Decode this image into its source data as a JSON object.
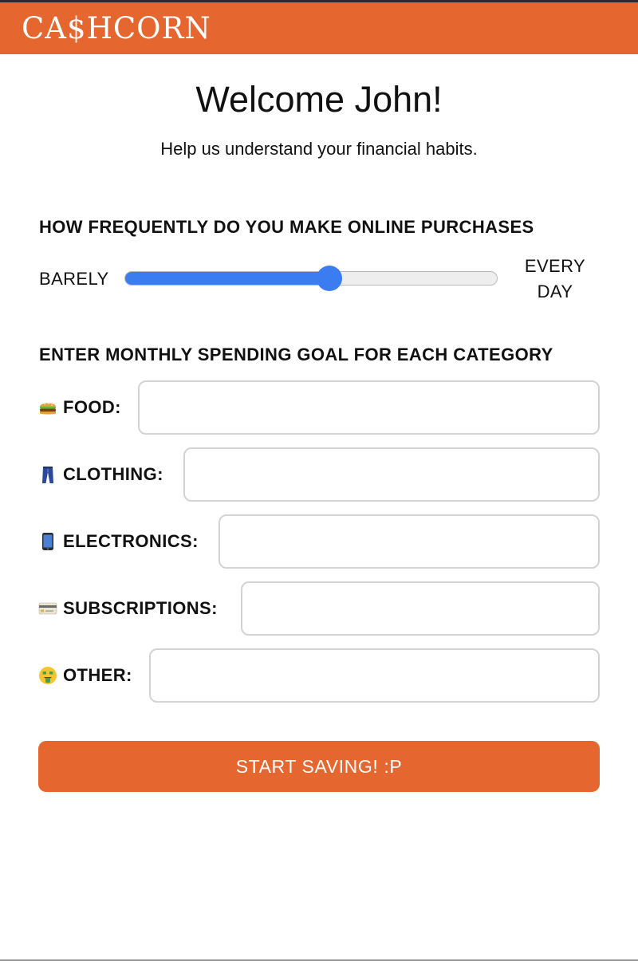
{
  "header": {
    "logo_text": "CA$HCORN",
    "logo_prefix": "CA",
    "logo_symbol": "$",
    "logo_suffix": "HCORN",
    "brand_color": "#e5672f"
  },
  "welcome": {
    "title": "Welcome John!",
    "subtitle": "Help us understand your financial habits."
  },
  "frequency": {
    "heading": "HOW FREQUENTLY DO YOU MAKE ONLINE PURCHASES",
    "min_label": "BARELY",
    "max_label": "EVERY DAY",
    "value_percent": 55,
    "accent_color": "#3b7cf0"
  },
  "spending": {
    "heading": "ENTER MONTHLY SPENDING GOAL FOR EACH CATEGORY",
    "categories": [
      {
        "icon": "burger-icon",
        "label": "FOOD:",
        "value": "",
        "placeholder": ""
      },
      {
        "icon": "jeans-icon",
        "label": "CLOTHING:",
        "value": "",
        "placeholder": ""
      },
      {
        "icon": "mobile-phone-icon",
        "label": "ELECTRONICS:",
        "value": "",
        "placeholder": ""
      },
      {
        "icon": "credit-card-icon",
        "label": "SUBSCRIPTIONS:",
        "value": "",
        "placeholder": ""
      },
      {
        "icon": "money-mouth-face-icon",
        "label": "OTHER:",
        "value": "",
        "placeholder": ""
      }
    ]
  },
  "submit": {
    "label": "START SAVING! :P"
  }
}
